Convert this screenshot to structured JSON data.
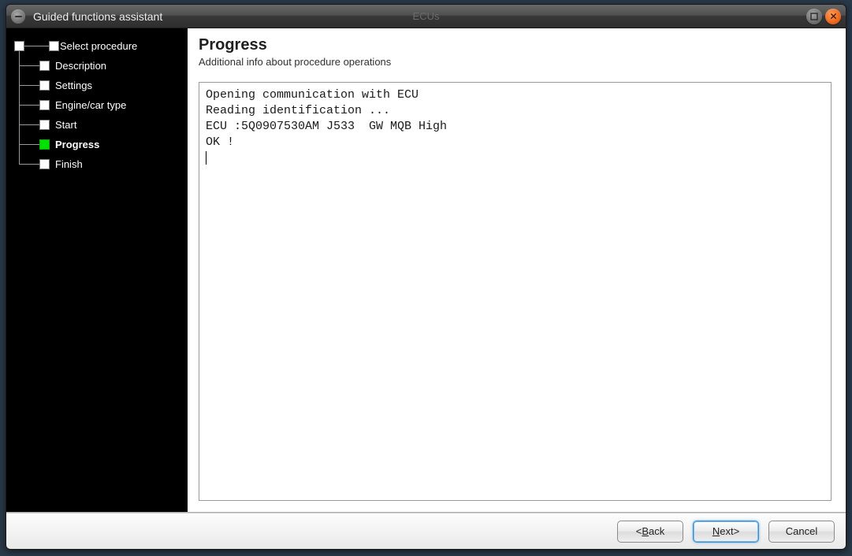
{
  "titlebar": {
    "title": "Guided functions assistant",
    "faded_center": "ECUs"
  },
  "sidebar": {
    "steps": [
      {
        "label": "Select procedure",
        "state": "done"
      },
      {
        "label": "Description",
        "state": "done"
      },
      {
        "label": "Settings",
        "state": "done"
      },
      {
        "label": "Engine/car type",
        "state": "done"
      },
      {
        "label": "Start",
        "state": "done"
      },
      {
        "label": "Progress",
        "state": "current"
      },
      {
        "label": "Finish",
        "state": "pending"
      }
    ]
  },
  "main": {
    "title": "Progress",
    "subtitle": "Additional info about procedure operations",
    "log": "Opening communication with ECU\nReading identification ...\nECU :5Q0907530AM J533  GW MQB High\nOK !"
  },
  "footer": {
    "back": {
      "prefix": "< ",
      "mnemonic": "B",
      "rest": "ack"
    },
    "next": {
      "mnemonic": "N",
      "rest": "ext",
      "suffix": " >"
    },
    "cancel": {
      "label": "Cancel"
    }
  }
}
